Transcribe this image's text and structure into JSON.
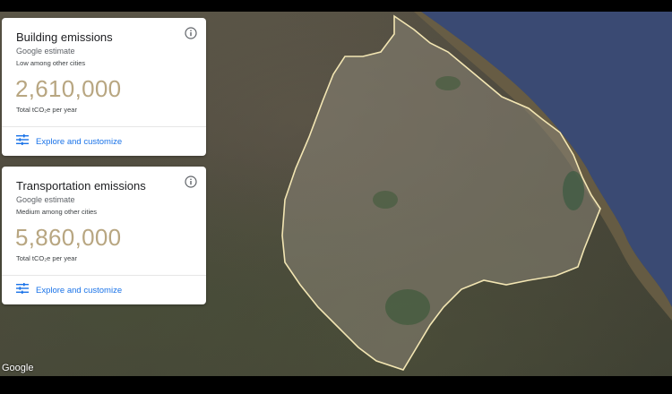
{
  "cards": [
    {
      "title": "Building emissions",
      "source": "Google estimate",
      "comparison": "Low among other cities",
      "value": "2,610,000",
      "unit": "Total tCO₂e per year",
      "action_label": "Explore and customize",
      "action_icon": "tune-icon",
      "info_icon": "info-icon"
    },
    {
      "title": "Transportation emissions",
      "source": "Google estimate",
      "comparison": "Medium among other cities",
      "value": "5,860,000",
      "unit": "Total tCO₂e per year",
      "action_label": "Explore and customize",
      "action_icon": "tune-icon",
      "info_icon": "info-icon"
    }
  ],
  "map": {
    "attribution": "Google",
    "boundary_color": "#f3e6b3",
    "water_color": "#3a4a73"
  },
  "colors": {
    "value_accent": "#b8a681",
    "link_blue": "#1a73e8"
  }
}
